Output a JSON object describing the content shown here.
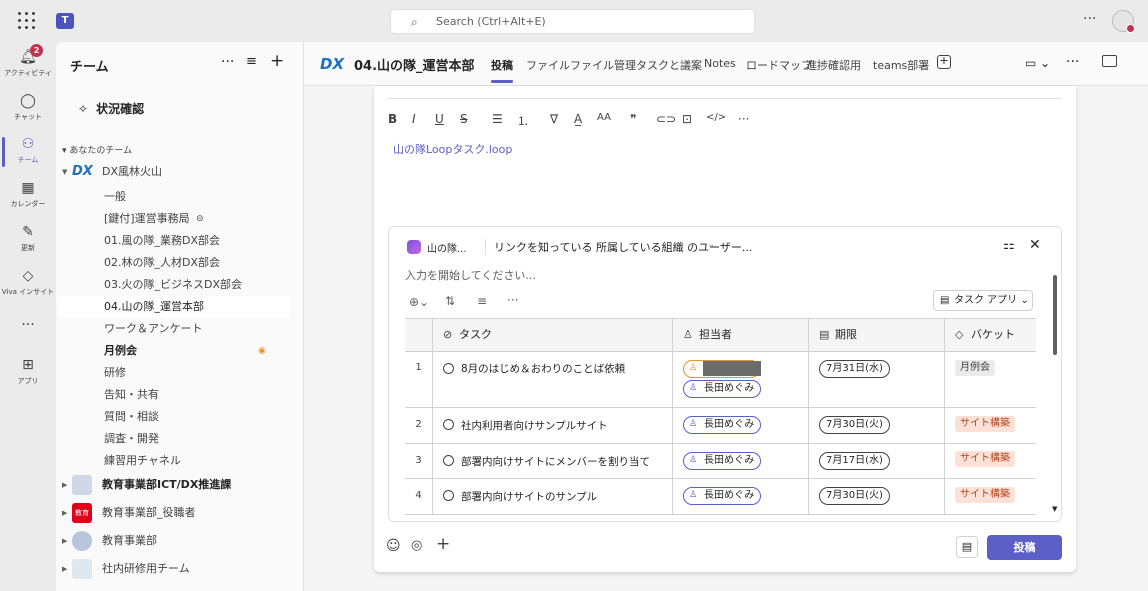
{
  "topbar": {
    "search_placeholder": "Search (Ctrl+Alt+E)",
    "more": "···"
  },
  "rail": {
    "items": [
      {
        "label": "アクティビティ",
        "icon": "bell-icon",
        "badge": "2"
      },
      {
        "label": "チャット",
        "icon": "chat-icon"
      },
      {
        "label": "チーム",
        "icon": "teams-icon"
      },
      {
        "label": "カレンダー",
        "icon": "calendar-icon"
      },
      {
        "label": "更新",
        "icon": "updates-icon"
      },
      {
        "label": "Viva インサイト",
        "icon": "viva-insights-icon"
      },
      {
        "label": "···",
        "icon": "more-icon"
      },
      {
        "label": "アプリ",
        "icon": "apps-icon"
      }
    ]
  },
  "teampanel": {
    "title": "チーム",
    "status_check": "状況確認",
    "your_teams": "あなたのチーム",
    "team1": {
      "name": "DX風林火山",
      "logo": "DX"
    },
    "channels": [
      "一般",
      "[鍵付]運営事務局",
      "01.風の隊_業務DX部会",
      "02.林の隊_人材DX部会",
      "03.火の隊_ビジネスDX部会",
      "04.山の隊_運営本部",
      "ワーク＆アンケート",
      "月例会",
      "研修",
      "告知・共有",
      "質問・相談",
      "調査・開発",
      "練習用チャネル"
    ],
    "teams": [
      {
        "name": "教育事業部ICT/DX推進課"
      },
      {
        "name": "教育事業部_役職者",
        "logo": "教育"
      },
      {
        "name": "教育事業部"
      },
      {
        "name": "社内研修用チーム"
      }
    ]
  },
  "header": {
    "logo": "DX",
    "title": "04.山の隊_運営本部",
    "tabs": [
      "投稿",
      "ファイル",
      "ファイル管理",
      "タスクと議案",
      "Notes",
      "ロードマップ",
      "進捗確認用",
      "teams部署"
    ]
  },
  "compose": {
    "loop_link": "山の隊Loopタスク.loop",
    "loop": {
      "name": "山の隊...",
      "share": "リンクを知っている 所属している組織 のユーザー...",
      "placeholder": "入力を開始してください...",
      "task_app": "タスク アプリ",
      "columns": [
        "タスク",
        "担当者",
        "期限",
        "バケット"
      ],
      "rows": [
        {
          "num": "1",
          "task": "8月のはじめ＆おわりのことば依頼",
          "assignees": [
            "",
            "長田めぐみ"
          ],
          "due": "7月31日(水)",
          "bucket": "月例会",
          "bucket_style": "gray"
        },
        {
          "num": "2",
          "task": "社内利用者向けサンプルサイト",
          "assignees": [
            "長田めぐみ"
          ],
          "due": "7月30日(火)",
          "bucket": "サイト構築",
          "bucket_style": "salmon"
        },
        {
          "num": "3",
          "task": "部署内向けサイトにメンバーを割り当て",
          "assignees": [
            "長田めぐみ"
          ],
          "due": "7月17日(水)",
          "bucket": "サイト構築",
          "bucket_style": "salmon"
        },
        {
          "num": "4",
          "task": "部署内向けサイトのサンプル",
          "assignees": [
            "長田めぐみ"
          ],
          "due": "7月30日(火)",
          "bucket": "サイト構築",
          "bucket_style": "salmon"
        }
      ]
    },
    "post_label": "投稿"
  }
}
